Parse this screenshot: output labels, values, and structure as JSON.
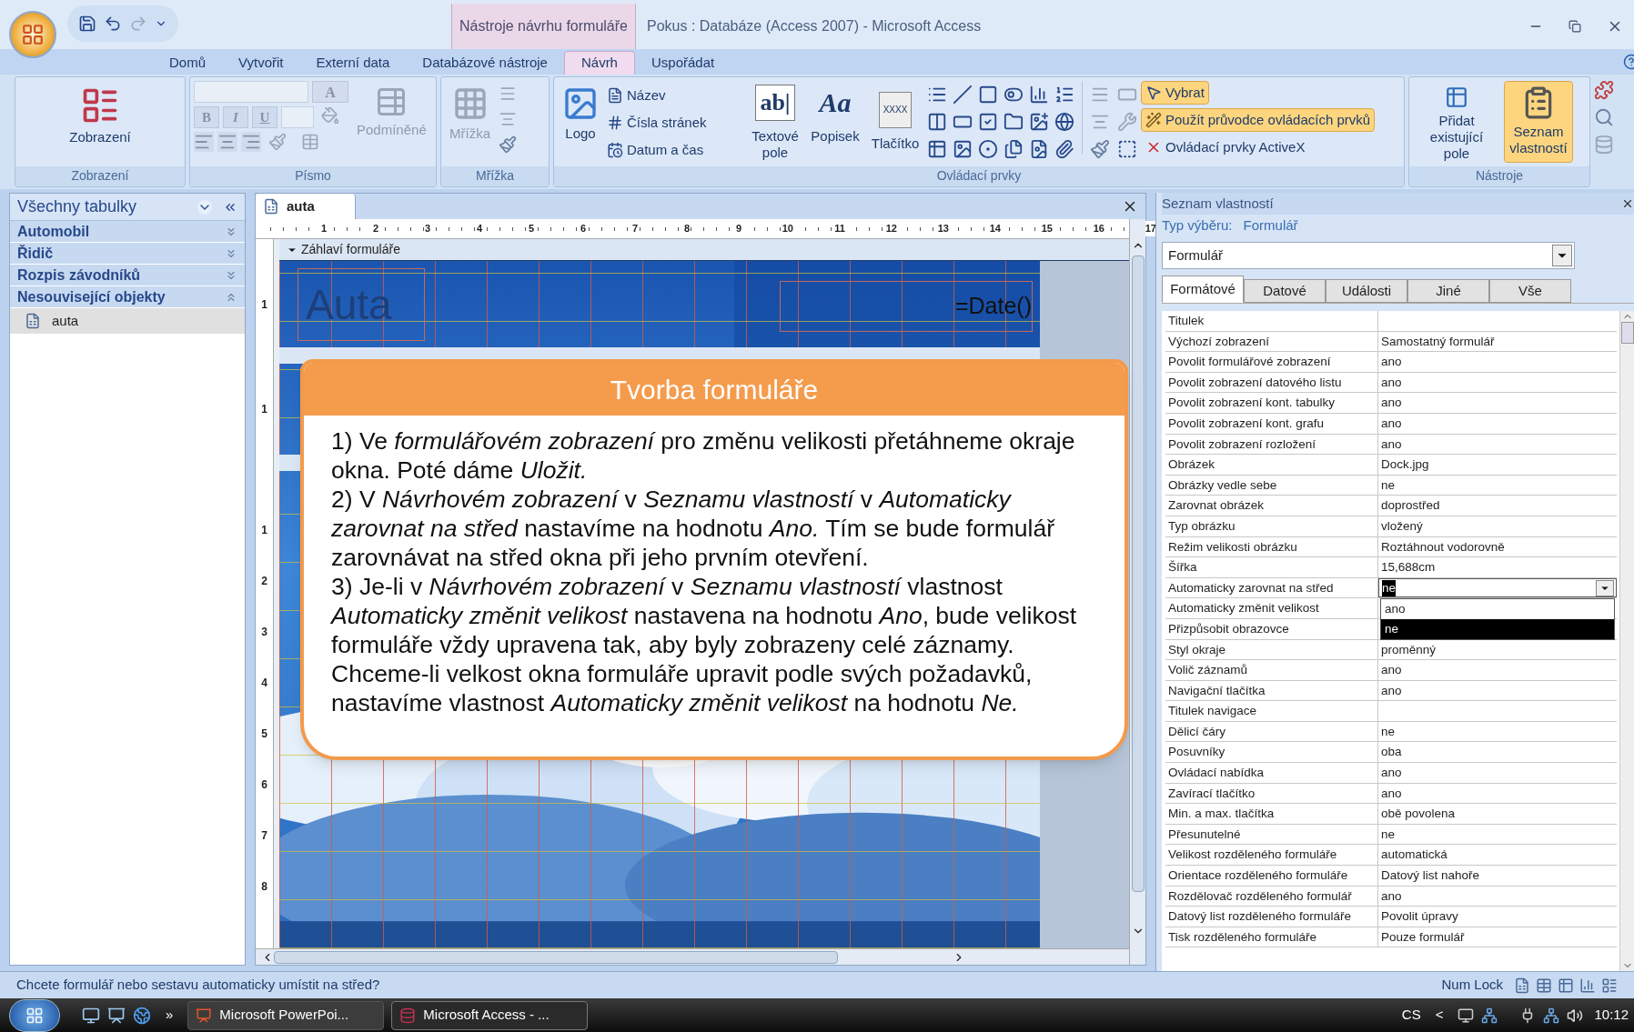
{
  "title_bar": {
    "context_tab": "Nástroje návrhu formuláře",
    "title": "Pokus : Databáze (Access 2007) - Microsoft Access"
  },
  "ribbon_tabs": [
    {
      "label": "Domů",
      "selected": false
    },
    {
      "label": "Vytvořit",
      "selected": false
    },
    {
      "label": "Externí data",
      "selected": false
    },
    {
      "label": "Databázové nástroje",
      "selected": false
    },
    {
      "label": "Návrh",
      "selected": true
    },
    {
      "label": "Uspořádat",
      "selected": false
    }
  ],
  "ribbon": {
    "groups": [
      {
        "label": "Zobrazení",
        "items": [
          {
            "label": "Zobrazení",
            "disabled": false
          }
        ]
      },
      {
        "label": "Písmo",
        "format_buttons": [
          "B",
          "I",
          "U"
        ],
        "font_color": "A",
        "items": [
          {
            "label": "Podmíněné",
            "disabled": true
          }
        ]
      },
      {
        "label": "Mřížka",
        "items": [
          {
            "label": "Mřížka",
            "disabled": true
          }
        ]
      },
      {
        "label": "Ovládací prvky",
        "items": [
          {
            "label": "Logo",
            "disabled": false
          }
        ],
        "header_footer": [
          "Název",
          "Čísla stránek",
          "Datum a čas"
        ],
        "controls": [
          {
            "glyph": "ab|",
            "label": "Textové pole"
          },
          {
            "glyph": "Aa",
            "label": "Popisek"
          },
          {
            "glyph": "XXXX",
            "label": "Tlačítko"
          }
        ],
        "tools": [
          {
            "label": "Vybrat",
            "highlighted": true
          },
          {
            "label": "Použít průvodce ovládacích prvků",
            "highlighted": true
          },
          {
            "label": "Ovládací prvky ActiveX",
            "highlighted": false
          }
        ]
      },
      {
        "label": "Nástroje",
        "items": [
          {
            "label": "Přidat existující pole",
            "highlighted": false
          },
          {
            "label": "Seznam vlastností",
            "highlighted": true
          }
        ]
      }
    ]
  },
  "navigation": {
    "header": "Všechny tabulky",
    "groups": [
      {
        "label": "Automobil",
        "expanded": false
      },
      {
        "label": "Řidič",
        "expanded": false
      },
      {
        "label": "Rozpis závodníků",
        "expanded": false
      },
      {
        "label": "Nesouvisející objekty",
        "expanded": true,
        "items": [
          {
            "label": "auta",
            "selected": true
          }
        ]
      }
    ]
  },
  "document": {
    "tab": "auta",
    "ruler": [
      "1",
      "2",
      "3",
      "4",
      "5",
      "6",
      "7",
      "8",
      "9",
      "10",
      "11",
      "12",
      "13",
      "14",
      "15",
      "16",
      "17"
    ],
    "vertical_ruler": [
      [
        "1"
      ],
      [
        "1"
      ],
      [
        "1",
        "2",
        "3",
        "4",
        "5",
        "6",
        "7",
        "8"
      ]
    ],
    "section": "Záhlaví formuláře",
    "form_title": "Auta",
    "date_field": "=Date()"
  },
  "callout": {
    "title": "Tvorba formuláře",
    "paragraphs": [
      "1) Ve *formulářovém zobrazení*  pro změnu velikosti přetáhneme okraje okna. Poté dáme *Uložit.*",
      "2) V *Návrhovém zobrazení* v *Seznamu vlastností* v *Automaticky zarovnat na střed* nastavíme na hodnotu *Ano.* Tím se bude formulář zarovnávat na střed okna při jeho prvním otevření.",
      "3) Je-li v *Návrhovém zobrazení* v *Seznamu vlastností* vlastnost *Automaticky změnit velikost* nastavena na hodnotu *Ano*, bude velikost formuláře vždy upravena tak, aby byly zobrazeny celé záznamy.",
      "Chceme-li velkost okna formuláře upravit podle svých požadavků, nastavíme vlastnost *Automaticky změnit velikost* na hodnotu *Ne.*"
    ]
  },
  "property_sheet": {
    "title": "Seznam vlastností",
    "selection_label": "Typ výběru:",
    "selection_type": "Formulář",
    "object": "Formulář",
    "tabs": [
      {
        "label": "Formátové",
        "selected": true
      },
      {
        "label": "Datové",
        "selected": false
      },
      {
        "label": "Události",
        "selected": false
      },
      {
        "label": "Jiné",
        "selected": false
      },
      {
        "label": "Vše",
        "selected": false
      }
    ],
    "rows": [
      {
        "name": "Titulek"
      },
      {
        "name": "Výchozí zobrazení",
        "value": "Samostatný formulář"
      },
      {
        "name": "Povolit formulářové zobrazení",
        "value": "ano"
      },
      {
        "name": "Povolit zobrazení datového listu",
        "value": "ano"
      },
      {
        "name": "Povolit zobrazení kont. tabulky",
        "value": "ano"
      },
      {
        "name": "Povolit zobrazení kont. grafu",
        "value": "ano"
      },
      {
        "name": "Povolit zobrazení rozložení",
        "value": "ano"
      },
      {
        "name": "Obrázek",
        "value": "Dock.jpg"
      },
      {
        "name": "Obrázky vedle sebe",
        "value": "ne"
      },
      {
        "name": "Zarovnat obrázek",
        "value": "doprostřed"
      },
      {
        "name": "Typ obrázku",
        "value": "vložený"
      },
      {
        "name": "Režim velikosti obrázku",
        "value": "Roztáhnout vodorovně"
      },
      {
        "name": "Šířka",
        "value": "15,688cm"
      },
      {
        "name": "Automaticky zarovnat na střed",
        "value": "ne",
        "editing": true,
        "options": [
          {
            "label": "ano",
            "selected": false
          },
          {
            "label": "ne",
            "selected": true
          }
        ]
      },
      {
        "name": "Automaticky změnit velikost"
      },
      {
        "name": "Přizpůsobit obrazovce"
      },
      {
        "name": "Styl okraje",
        "value": "proměnný"
      },
      {
        "name": "Volič záznamů",
        "value": "ano"
      },
      {
        "name": "Navigační tlačítka",
        "value": "ano"
      },
      {
        "name": "Titulek navigace"
      },
      {
        "name": "Dělicí čáry",
        "value": "ne"
      },
      {
        "name": "Posuvníky",
        "value": "oba"
      },
      {
        "name": "Ovládací nabídka",
        "value": "ano"
      },
      {
        "name": "Zavírací tlačítko",
        "value": "ano"
      },
      {
        "name": "Min. a max. tlačítka",
        "value": "obě povolena"
      },
      {
        "name": "Přesunutelné",
        "value": "ne"
      },
      {
        "name": "Velikost rozděleného formuláře",
        "value": "automatická"
      },
      {
        "name": "Orientace rozděleného formuláře",
        "value": "Datový list nahoře"
      },
      {
        "name": "Rozdělovač rozděleného formulář",
        "value": "ano"
      },
      {
        "name": "Datový list rozděleného formuláře",
        "value": "Povolit úpravy"
      },
      {
        "name": "Tisk rozděleného formuláře",
        "value": "Pouze formulář"
      }
    ]
  },
  "status_bar": {
    "message": "Chcete formulář nebo sestavu automaticky umístit na střed?",
    "indicator": "Num Lock"
  },
  "taskbar": {
    "overflow": "»",
    "tasks": [
      {
        "label": "Microsoft PowerPoi...",
        "selected": false
      },
      {
        "label": "Microsoft Access - ...",
        "selected": true
      }
    ],
    "language": "CS",
    "tray_toggle": "<",
    "clock": "10:12"
  }
}
